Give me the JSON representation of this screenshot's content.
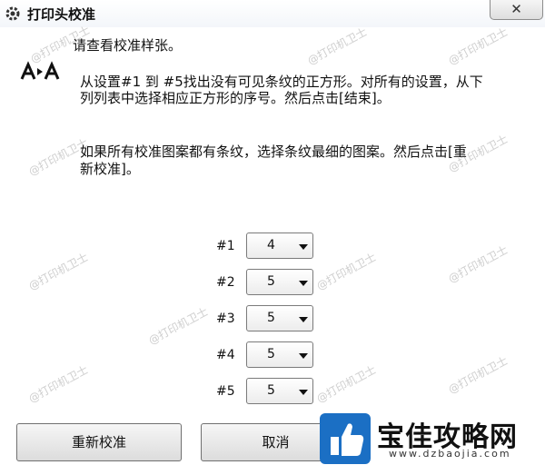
{
  "window": {
    "title": "打印头校准",
    "close_label": "✕"
  },
  "instructions": {
    "heading": "请查看校准样张。",
    "para1_line1": "从设置#1 到 #5找出没有可见条纹的正方形。对所有的设置，从下",
    "para1_line2": "列列表中选择相应正方形的序号。然后点击[结束]。",
    "para2_line1": "如果所有校准图案都有条纹，选择条纹最细的图案。然后点击[重",
    "para2_line2": "新校准]。"
  },
  "settings": {
    "rows": [
      {
        "label": "#1",
        "value": "4"
      },
      {
        "label": "#2",
        "value": "5"
      },
      {
        "label": "#3",
        "value": "5"
      },
      {
        "label": "#4",
        "value": "5"
      },
      {
        "label": "#5",
        "value": "5"
      }
    ]
  },
  "buttons": {
    "recalibrate": "重新校准",
    "cancel": "取消"
  },
  "watermark": {
    "text": "@打印机卫士"
  },
  "brand": {
    "name": "宝佳攻略网",
    "url": "www.dzbaojia.com"
  },
  "colors": {
    "logo_blue": "#1b6fc4",
    "titlebar": "#f3f6fa"
  }
}
